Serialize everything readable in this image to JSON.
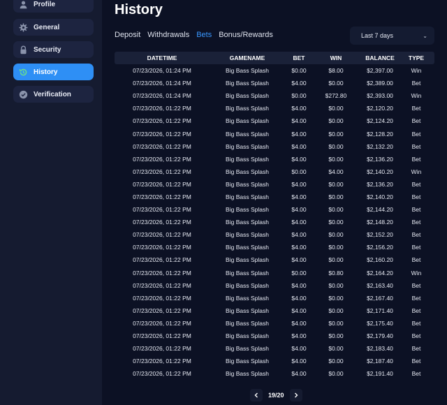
{
  "sidebar": {
    "items": [
      {
        "label": "Profile",
        "icon": "user-icon"
      },
      {
        "label": "General",
        "icon": "gear-icon"
      },
      {
        "label": "Security",
        "icon": "lock-icon"
      },
      {
        "label": "History",
        "icon": "history-icon"
      },
      {
        "label": "Verification",
        "icon": "check-circle-icon"
      }
    ],
    "active": "History"
  },
  "header": {
    "title": "History"
  },
  "tabs": [
    {
      "label": "Deposit"
    },
    {
      "label": "Withdrawals"
    },
    {
      "label": "Bets",
      "active": true
    },
    {
      "label": "Bonus/Rewards"
    }
  ],
  "filter": {
    "selected": "Last 7 days",
    "icon": "chevron-down-icon"
  },
  "table": {
    "columns": [
      "DATETIME",
      "GAMENAME",
      "BET",
      "WIN",
      "BALANCE",
      "TYPE"
    ],
    "rows": [
      [
        "07/23/2026, 01:24 PM",
        "Big Bass Splash",
        "$0.00",
        "$8.00",
        "$2,397.00",
        "Win"
      ],
      [
        "07/23/2026, 01:24 PM",
        "Big Bass Splash",
        "$4.00",
        "$0.00",
        "$2,389.00",
        "Bet"
      ],
      [
        "07/23/2026, 01:24 PM",
        "Big Bass Splash",
        "$0.00",
        "$272.80",
        "$2,393.00",
        "Win"
      ],
      [
        "07/23/2026, 01:22 PM",
        "Big Bass Splash",
        "$4.00",
        "$0.00",
        "$2,120.20",
        "Bet"
      ],
      [
        "07/23/2026, 01:22 PM",
        "Big Bass Splash",
        "$4.00",
        "$0.00",
        "$2,124.20",
        "Bet"
      ],
      [
        "07/23/2026, 01:22 PM",
        "Big Bass Splash",
        "$4.00",
        "$0.00",
        "$2,128.20",
        "Bet"
      ],
      [
        "07/23/2026, 01:22 PM",
        "Big Bass Splash",
        "$4.00",
        "$0.00",
        "$2,132.20",
        "Bet"
      ],
      [
        "07/23/2026, 01:22 PM",
        "Big Bass Splash",
        "$4.00",
        "$0.00",
        "$2,136.20",
        "Bet"
      ],
      [
        "07/23/2026, 01:22 PM",
        "Big Bass Splash",
        "$0.00",
        "$4.00",
        "$2,140.20",
        "Win"
      ],
      [
        "07/23/2026, 01:22 PM",
        "Big Bass Splash",
        "$4.00",
        "$0.00",
        "$2,136.20",
        "Bet"
      ],
      [
        "07/23/2026, 01:22 PM",
        "Big Bass Splash",
        "$4.00",
        "$0.00",
        "$2,140.20",
        "Bet"
      ],
      [
        "07/23/2026, 01:22 PM",
        "Big Bass Splash",
        "$4.00",
        "$0.00",
        "$2,144.20",
        "Bet"
      ],
      [
        "07/23/2026, 01:22 PM",
        "Big Bass Splash",
        "$4.00",
        "$0.00",
        "$2,148.20",
        "Bet"
      ],
      [
        "07/23/2026, 01:22 PM",
        "Big Bass Splash",
        "$4.00",
        "$0.00",
        "$2,152.20",
        "Bet"
      ],
      [
        "07/23/2026, 01:22 PM",
        "Big Bass Splash",
        "$4.00",
        "$0.00",
        "$2,156.20",
        "Bet"
      ],
      [
        "07/23/2026, 01:22 PM",
        "Big Bass Splash",
        "$4.00",
        "$0.00",
        "$2,160.20",
        "Bet"
      ],
      [
        "07/23/2026, 01:22 PM",
        "Big Bass Splash",
        "$0.00",
        "$0.80",
        "$2,164.20",
        "Win"
      ],
      [
        "07/23/2026, 01:22 PM",
        "Big Bass Splash",
        "$4.00",
        "$0.00",
        "$2,163.40",
        "Bet"
      ],
      [
        "07/23/2026, 01:22 PM",
        "Big Bass Splash",
        "$4.00",
        "$0.00",
        "$2,167.40",
        "Bet"
      ],
      [
        "07/23/2026, 01:22 PM",
        "Big Bass Splash",
        "$4.00",
        "$0.00",
        "$2,171.40",
        "Bet"
      ],
      [
        "07/23/2026, 01:22 PM",
        "Big Bass Splash",
        "$4.00",
        "$0.00",
        "$2,175.40",
        "Bet"
      ],
      [
        "07/23/2026, 01:22 PM",
        "Big Bass Splash",
        "$4.00",
        "$0.00",
        "$2,179.40",
        "Bet"
      ],
      [
        "07/23/2026, 01:22 PM",
        "Big Bass Splash",
        "$4.00",
        "$0.00",
        "$2,183.40",
        "Bet"
      ],
      [
        "07/23/2026, 01:22 PM",
        "Big Bass Splash",
        "$4.00",
        "$0.00",
        "$2,187.40",
        "Bet"
      ],
      [
        "07/23/2026, 01:22 PM",
        "Big Bass Splash",
        "$4.00",
        "$0.00",
        "$2,191.40",
        "Bet"
      ]
    ]
  },
  "pagination": {
    "label": "19/20",
    "prev_icon": "chevron-left-icon",
    "next_icon": "chevron-right-icon"
  },
  "colors": {
    "background": "#0c1124",
    "sidebar": "#151b30",
    "accent": "#2e8ff5",
    "active_tab": "#3a98ff"
  }
}
